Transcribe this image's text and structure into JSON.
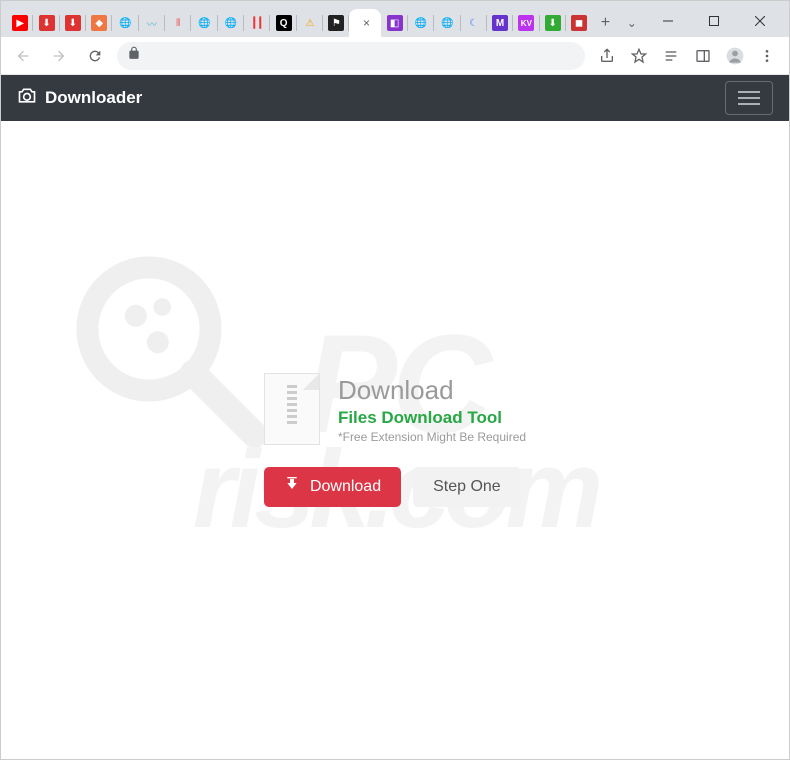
{
  "window": {
    "minimize": "—",
    "maximize": "☐",
    "close": "✕"
  },
  "tabs": {
    "active_close": "×",
    "new_tab": "+"
  },
  "navbar": {
    "brand": "Downloader"
  },
  "card": {
    "title": "Download",
    "subtitle": "Files Download Tool",
    "note": "*Free Extension Might Be Required"
  },
  "buttons": {
    "download": "Download",
    "step_one": "Step One"
  },
  "watermark": {
    "line1": "PC",
    "line2": "risk.com"
  }
}
